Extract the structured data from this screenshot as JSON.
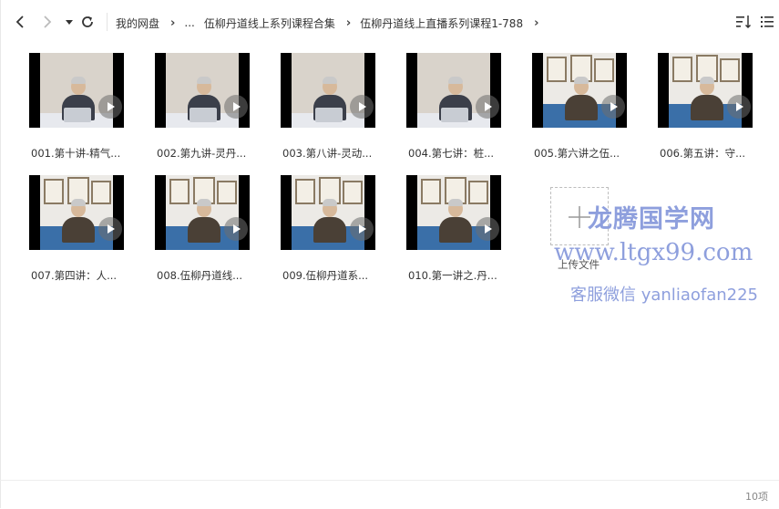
{
  "breadcrumb": {
    "items": [
      "我的网盘",
      "...",
      "伍柳丹道线上系列课程合集",
      "伍柳丹道线上直播系列课程1-788"
    ]
  },
  "files": [
    {
      "name": "001.第十讲-精气...",
      "style": "desk"
    },
    {
      "name": "002.第九讲-灵丹...",
      "style": "desk"
    },
    {
      "name": "003.第八讲-灵动...",
      "style": "desk"
    },
    {
      "name": "004.第七讲：桩...",
      "style": "desk"
    },
    {
      "name": "005.第六讲之伍...",
      "style": "frames"
    },
    {
      "name": "006.第五讲：守...",
      "style": "frames"
    },
    {
      "name": "007.第四讲：人...",
      "style": "frames"
    },
    {
      "name": "008.伍柳丹道线...",
      "style": "frames"
    },
    {
      "name": "009.伍柳丹道系...",
      "style": "frames"
    },
    {
      "name": "010.第一讲之.丹...",
      "style": "frames"
    }
  ],
  "upload": {
    "label": "上传文件"
  },
  "watermark": {
    "line1": "龙腾国学网",
    "line2": "www.ltgx99.com",
    "line3": "客服微信 yanliaofan225",
    "color": "#7b8fd8"
  },
  "footer": {
    "count": "10项"
  }
}
